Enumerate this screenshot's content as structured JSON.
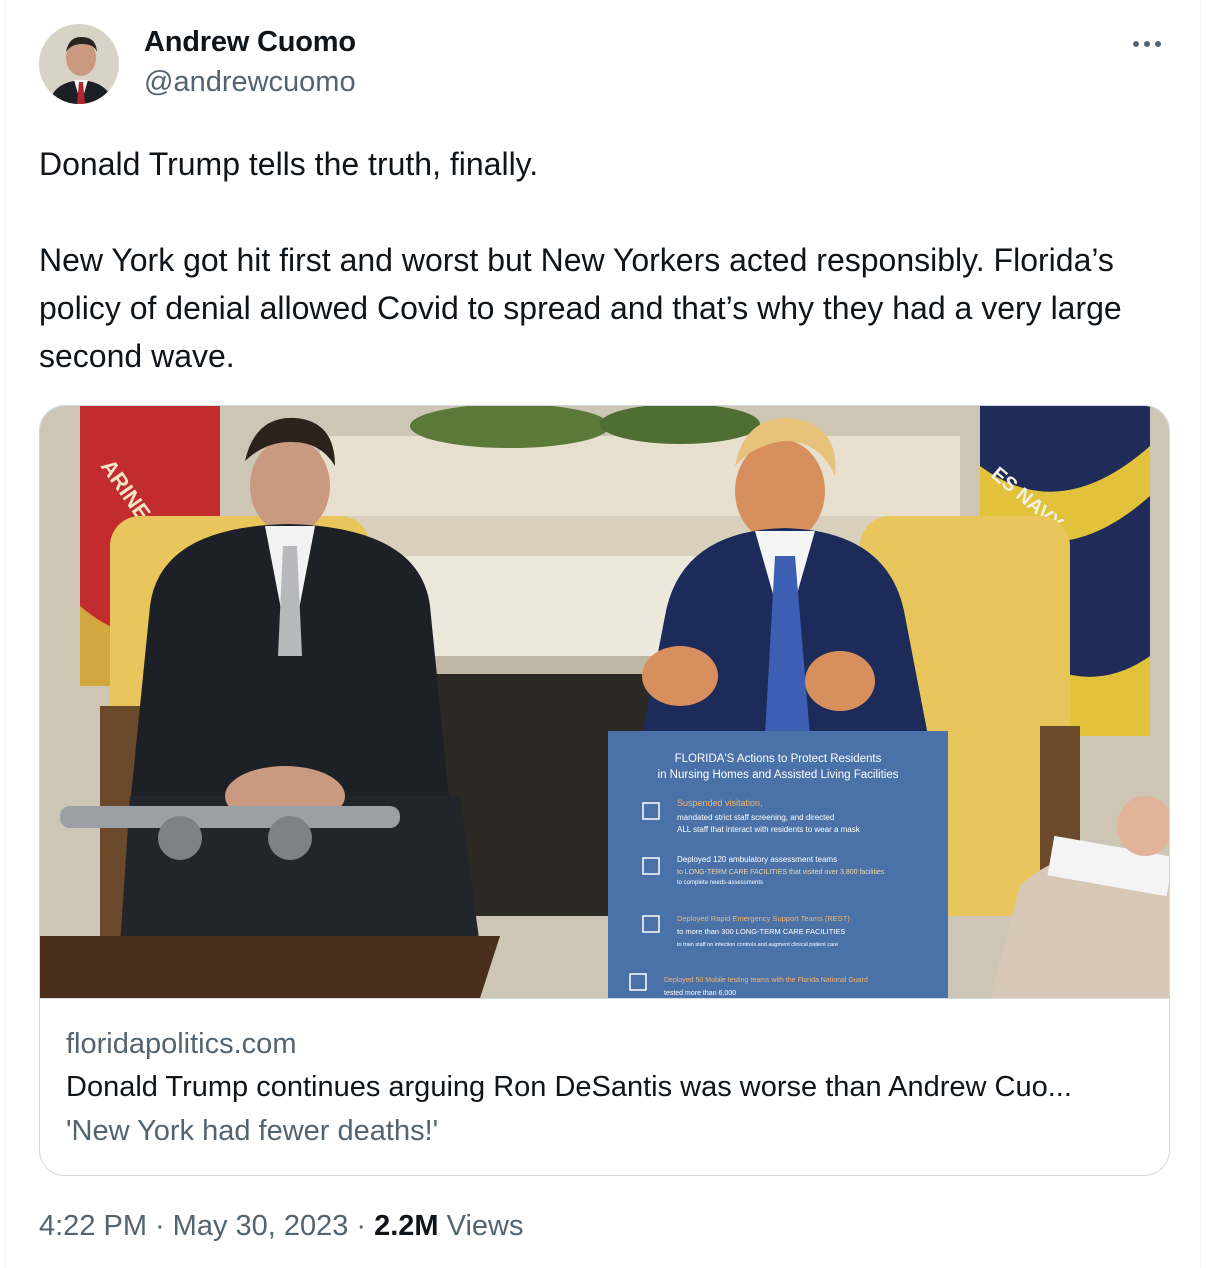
{
  "author": {
    "display_name": "Andrew Cuomo",
    "handle": "@andrewcuomo"
  },
  "more_icon": "more-horizontal-icon",
  "tweet": {
    "line1": "Donald Trump tells the truth, finally.",
    "line2": "New York got hit first and worst but New Yorkers acted responsibly. Florida’s policy of denial allowed Covid to spread and that’s why they had a very large second wave."
  },
  "link_card": {
    "domain": "floridapolitics.com",
    "title": "Donald Trump continues arguing Ron DeSantis was worse than Andrew Cuo...",
    "description": "'New York had fewer deaths!'",
    "image": {
      "flag_left_text": "ARINE",
      "flag_right_text": "ES NAVY",
      "sign": {
        "heading1": "FLORIDA'S Actions to Protect Residents",
        "heading2": "in Nursing Homes and Assisted Living Facilities",
        "item1_a": "Suspended visitation,",
        "item1_b": "mandated strict staff screening, and directed",
        "item1_c": "ALL staff that interact with residents to wear a mask",
        "item2_a": "Deployed 120 ambulatory assessment teams",
        "item2_b": "to LONG-TERM CARE FACILITIES that visited over 3,800 facilities",
        "item2_c": "to complete needs-assessments",
        "item3_a": "Deployed Rapid Emergency Support Teams (REST)",
        "item3_b": "to more than 300 LONG-TERM CARE FACILITIES",
        "item3_c": "to train staff on infection controls and augment clinical patient care",
        "item4_a": "Deployed 50 Mobile testing teams with the Florida National Guard",
        "item4_b": "tested more than 6,000"
      }
    }
  },
  "meta": {
    "time": "4:22 PM",
    "separator": "·",
    "date": "May 30, 2023",
    "views_count": "2.2M",
    "views_label": "Views"
  },
  "colors": {
    "text_primary": "#0f1419",
    "text_secondary": "#536471",
    "border": "#cfd9de"
  }
}
